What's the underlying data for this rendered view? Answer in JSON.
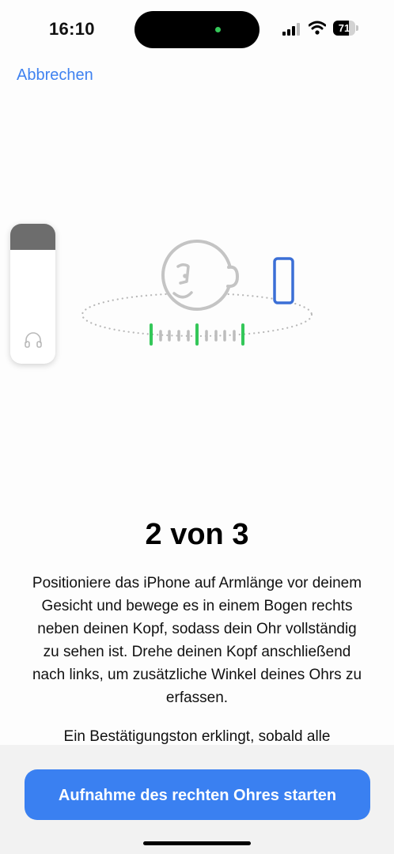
{
  "status_bar": {
    "time": "16:10",
    "battery_level": "71",
    "battery_percent": 71,
    "icons": [
      "cellular-signal-icon",
      "wifi-icon",
      "battery-icon"
    ]
  },
  "nav": {
    "cancel_label": "Abbrechen"
  },
  "colors": {
    "accent": "#3a80f1",
    "link": "#3f82f0",
    "progress_green": "#34c759",
    "phone_outline": "#3b6fd6",
    "face_outline": "#c4c4c4"
  },
  "illustration": {
    "icons": [
      "face-outline-icon",
      "phone-outline-icon",
      "headphones-icon"
    ]
  },
  "step": {
    "title": "2 von 3",
    "description": "Positioniere das iPhone auf Armlänge vor deinem Gesicht und bewege es in einem Bogen rechts neben deinen Kopf, sodass dein Ohr vollständig zu sehen ist. Drehe deinen Kopf anschließend nach links, um zusätzliche Winkel deines Ohrs zu erfassen.",
    "confirmation": "Ein Bestätigungston erklingt, sobald alle"
  },
  "action": {
    "start_label": "Aufnahme des rechten Ohres starten"
  }
}
